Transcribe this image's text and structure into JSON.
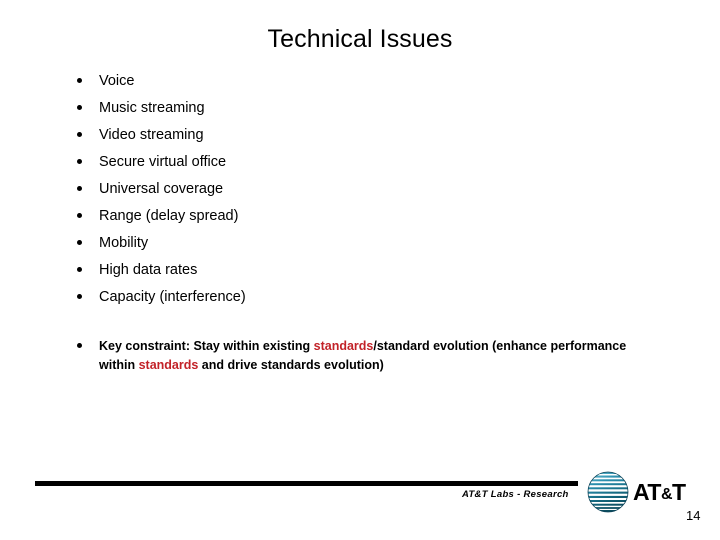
{
  "slide": {
    "title": "Technical Issues",
    "page_number": "14",
    "bullets": [
      {
        "label": "Voice"
      },
      {
        "label": "Music streaming"
      },
      {
        "label": "Video streaming"
      },
      {
        "label": "Secure virtual office"
      },
      {
        "label": "Universal coverage"
      },
      {
        "label": "Range (delay spread)"
      },
      {
        "label": "Mobility"
      },
      {
        "label": "High data rates"
      },
      {
        "label": "Capacity (interference)"
      }
    ],
    "constraint": {
      "segment_1": "Key constraint: Stay within existing ",
      "highlight_1": "standards",
      "segment_2": "/standard evolution (enhance performance within ",
      "highlight_2": "standards",
      "segment_3": " and drive standards evolution)"
    }
  },
  "footer": {
    "label": "AT&T Labs - Research",
    "logo_wordmark_left": "AT",
    "logo_wordmark_amp": "&",
    "logo_wordmark_right": "T"
  },
  "colors": {
    "highlight_red": "#c22228",
    "globe_blue": "#1c7f9c",
    "text_black": "#000000"
  }
}
